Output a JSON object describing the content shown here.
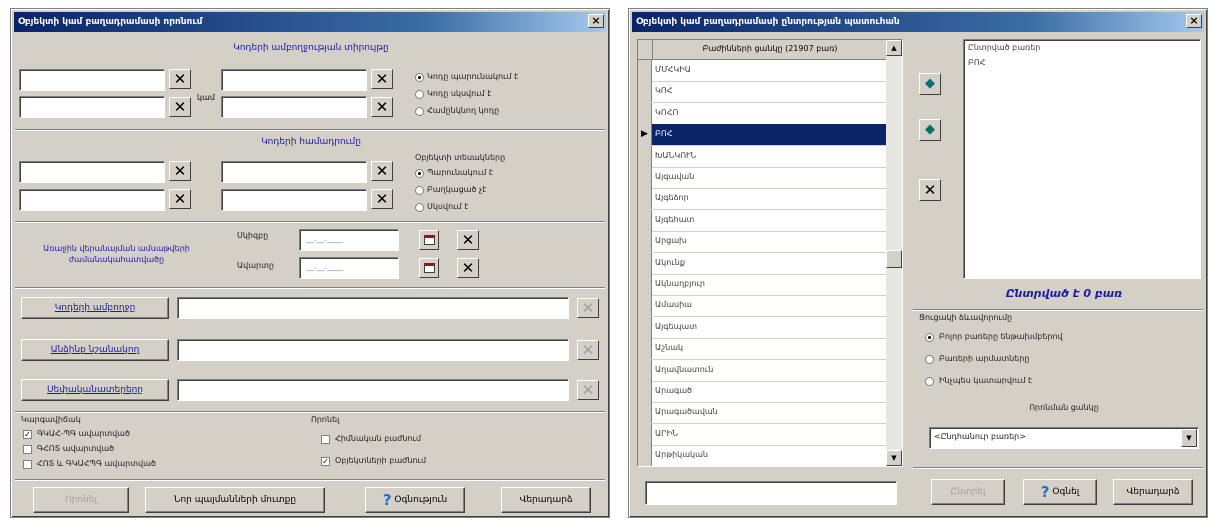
{
  "left_window": {
    "title": "Օբյեկտի կամ բաղադրամասի որոնում",
    "close_label": "×",
    "section1_heading": "Կոդերի ամբողջության տիրույթը",
    "between_label": "կամ",
    "code_options": [
      "Կոդը պարունակում է",
      "Կոդը սկսվում է",
      "Համընկնող կոդը"
    ],
    "section2_heading": "Կոդերի համադրումը",
    "object_type_group_label": "Օբյեկտի տեսակները",
    "type_options": [
      "Պարունակում է",
      "Բաղկացած չէ",
      "Սկսվում է"
    ],
    "date_section_label": "Առաջին վերանայման ամսաթվերի ժամանակահատվածը",
    "date_from_label": "Սկիզբը",
    "date_to_label": "Ավարտը",
    "date_placeholder": "__.__.____",
    "button_object": "Կոդերի ամբողջը",
    "button_person": "Անձինք նշանակող",
    "button_owner": "Սեփականատերերը",
    "status_label": "Կարգավիճակ",
    "status_options": [
      "ԳԿԱՀ-ՊԳ ավարտված",
      "ԳՀՈՏ ավարտված",
      "ՀՈՏ և ԳԿԱՀՊԳ ավարտված"
    ],
    "search_label": "Որոնել",
    "search_options": [
      "Հիմնական բաժնում",
      "Օբյեկտների բաժնում"
    ],
    "button_search": "Որոնել",
    "button_clear": "Նոր պայմանների մուտքը",
    "button_help": "Օգնություն",
    "button_exit": "Վերադարձ",
    "help_icon_glyph": "?"
  },
  "right_window": {
    "title": "Օբյեկտի կամ բաղադրամասի ընտրության պատուհան",
    "close_label": "×",
    "list_header": "Բաժինների ցանկը (21907 բառ)",
    "list_items": [
      "ՄՄՀԿԻԱ",
      "ԿՈՀ",
      "ԿՈՀՈ",
      "ԲՈՀ",
      "ԽԱՆԿՈՒՆ",
      "Այգավան",
      "Այգեձոր",
      "Այգեհատ",
      "Արցախ",
      "Ակունք",
      "Ակնաղբյուր",
      "Ամասիա",
      "Այգեպատ",
      "Աշնակ",
      "Աղավնատուն",
      "Արագած",
      "Արագածավան",
      "ԱՐԻՆ",
      "Արթիկական"
    ],
    "active_index": 3,
    "selected_header": "Ընտրված բառեր",
    "selected_items": [
      "ԲՈՀ"
    ],
    "count_label": "Ընտրված է 0 բառ",
    "sort_group_label": "Ցուցակի ձևավորումը",
    "sort_options": [
      "Բոլոր բառերը ենթախմբերով",
      "Բառերի արմատները",
      "Ինչպես կատարվում է"
    ],
    "scope_label": "Որոնման ցանկը",
    "scope_value": "<Ընդհանուր բառեր>",
    "filter_value": "",
    "button_ok": "Ընտրել",
    "button_help": "Օգնել",
    "button_exit": "Վերադարձ",
    "add_icon_glyph": "◆",
    "help_icon_glyph": "?"
  }
}
